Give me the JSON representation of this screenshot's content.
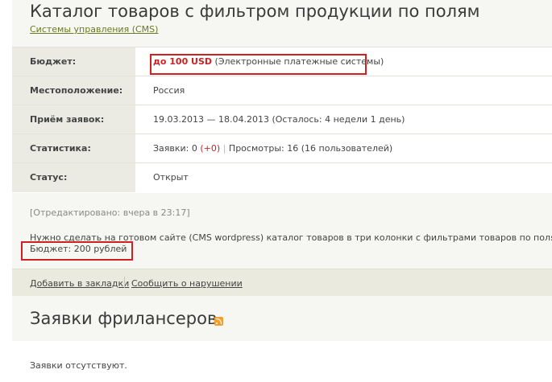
{
  "project": {
    "title": "Каталог товаров с фильтром продукции по полям",
    "category": "Системы управления (CMS)"
  },
  "info": {
    "budget_label": "Бюджет:",
    "budget_amount": "до 100 USD",
    "budget_note": "(Электронные платежные системы)",
    "location_label": "Местоположение:",
    "location_value": "Россия",
    "accept_label": "Приём заявок:",
    "accept_value": "19.03.2013 — 18.04.2013 (Осталось: 4 недели 1 день)",
    "stats_label": "Статистика:",
    "stats_bids_text": "Заявки: 0",
    "stats_bids_plus": "(+0)",
    "stats_sep": "|",
    "stats_views_text": "Просмотры: 16 (16 пользователей)",
    "status_label": "Статус:",
    "status_value": "Открыт"
  },
  "description": {
    "edited": "[Отредактировано: вчера в 23:17]",
    "line1": "Нужно сделать на готовом сайте (CMS wordpress) каталог товаров в три колонки с фильтрами товаров по полям.",
    "line2": "Бюджет: 200 рублей"
  },
  "actions": {
    "bookmark": "Добавить в закладки",
    "report": "Сообщить о нарушении"
  },
  "bids": {
    "title": "Заявки фрилансеров",
    "rss_icon": "rss-icon",
    "empty": "Заявки отсутствуют."
  },
  "colors": {
    "accent_red": "#cc2222",
    "highlight_box": "#d21f1f",
    "link_green": "#6a7a22"
  }
}
